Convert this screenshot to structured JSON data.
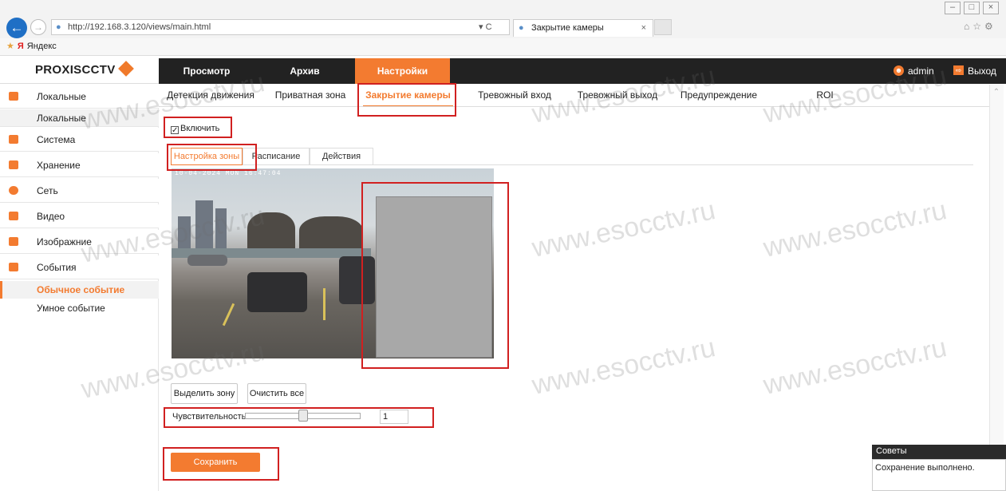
{
  "browser": {
    "url": "http://192.168.3.120/views/main.html",
    "refresh_symbol": "▾ C",
    "tab_title": "Закрытие камеры",
    "tab_close": "×",
    "favorites": "Яндекс"
  },
  "app": {
    "logo": "PROXISCCTV",
    "nav": {
      "view": "Просмотр",
      "archive": "Архив",
      "settings": "Настройки"
    },
    "user": "admin",
    "exit": "Выход"
  },
  "sidebar": {
    "local": "Локальные",
    "local_sub": "Локальные",
    "system": "Система",
    "storage": "Хранение",
    "network": "Сеть",
    "video": "Видео",
    "image": "Изображние",
    "events": "События",
    "normal_event": "Обычное событие",
    "smart_event": "Умное событие"
  },
  "subtabs": {
    "motion": "Детекция движения",
    "privacy": "Приватная зона",
    "tamper": "Закрытие камеры",
    "alarm_in": "Тревожный вход",
    "alarm_out": "Тревожный выход",
    "warning": "Предупреждение",
    "roi": "ROI"
  },
  "content": {
    "enable_label": "Включить",
    "enable_checked": true,
    "steps": {
      "zone": "Настройка зоны",
      "schedule": "Расписание",
      "actions": "Действия"
    },
    "camera_timestamp": "10-04-2024 MON 16:47:04",
    "btn_select_zone": "Выделить зону",
    "btn_clear_all": "Очистить все",
    "sensitivity_label": "Чувствительность",
    "sensitivity_value": "1",
    "save": "Сохранить"
  },
  "tips": {
    "title": "Советы",
    "message": "Сохранение выполнено."
  },
  "watermark": "www.esocctv.ru",
  "colors": {
    "accent": "#f37b30",
    "highlight": "#d12020"
  }
}
